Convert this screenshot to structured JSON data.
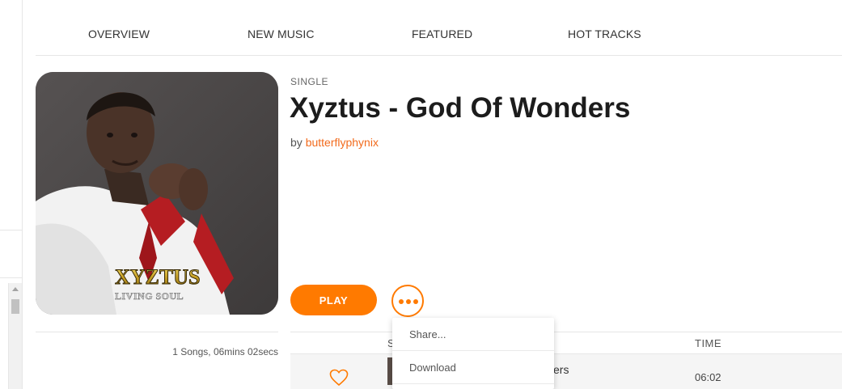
{
  "nav": {
    "items": [
      {
        "label": "OVERVIEW"
      },
      {
        "label": "NEW MUSIC"
      },
      {
        "label": "FEATURED"
      },
      {
        "label": "HOT TRACKS"
      }
    ]
  },
  "release": {
    "kind": "SINGLE",
    "title": "Xyztus - God Of Wonders",
    "by_prefix": "by",
    "artist": "butterflyphynix",
    "cover_text": {
      "line1": "XYZTUS",
      "line2": "LIVING SOUL"
    },
    "stats": "1 Songs, 06mins 02secs"
  },
  "actions": {
    "play_label": "PLAY",
    "more_icon": "more-dots-icon"
  },
  "menu": {
    "items": [
      {
        "label": "Share..."
      },
      {
        "label": "Download"
      }
    ]
  },
  "tracks": {
    "headers": {
      "song": "S",
      "time": "TIME"
    },
    "rows": [
      {
        "title_fragment": "ers",
        "time": "06:02"
      }
    ]
  },
  "colors": {
    "accent": "#ff7a00",
    "artist_link": "#f26b1d"
  }
}
